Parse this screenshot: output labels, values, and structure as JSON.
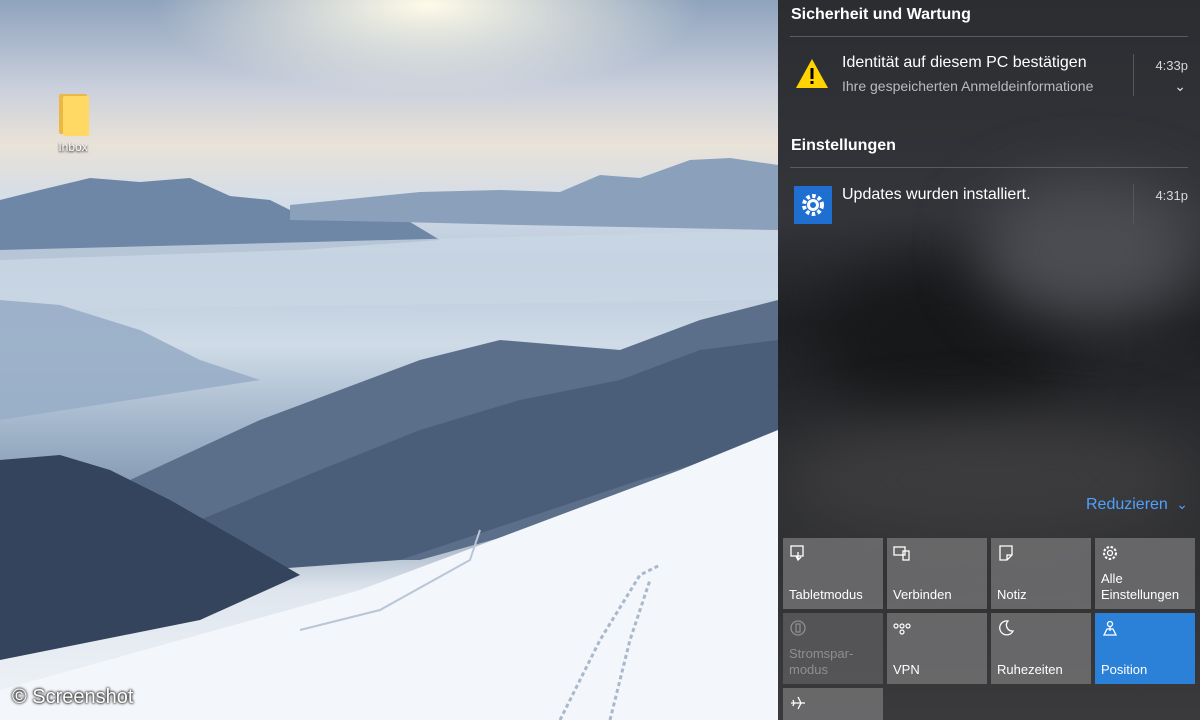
{
  "desktop": {
    "icons": [
      {
        "label": "Inbox",
        "icon": "folder-icon"
      }
    ],
    "watermark": "© Screenshot"
  },
  "action_center": {
    "sections": [
      {
        "title": "Sicherheit und Wartung",
        "notifications": [
          {
            "icon": "warning-icon",
            "title": "Identität auf diesem PC bestätigen",
            "subtitle": "Ihre gespeicherten Anmeldeinformatione",
            "time": "4:33p"
          }
        ]
      },
      {
        "title": "Einstellungen",
        "notifications": [
          {
            "icon": "gear-icon",
            "title": "Updates wurden installiert.",
            "time": "4:31p"
          }
        ]
      }
    ],
    "collapse_label": "Reduzieren",
    "accent_color": "#2b80d8",
    "quick_actions": [
      {
        "label": "Tabletmodus",
        "icon": "tablet-mode-icon",
        "state": "normal"
      },
      {
        "label": "Verbinden",
        "icon": "connect-icon",
        "state": "normal"
      },
      {
        "label": "Notiz",
        "icon": "note-icon",
        "state": "normal"
      },
      {
        "label": "Alle\nEinstellungen",
        "icon": "settings-icon",
        "state": "normal"
      },
      {
        "label": "Stromspar-\nmodus",
        "icon": "battery-saver-icon",
        "state": "disabled"
      },
      {
        "label": "VPN",
        "icon": "vpn-icon",
        "state": "normal"
      },
      {
        "label": "Ruhezeiten",
        "icon": "moon-icon",
        "state": "normal"
      },
      {
        "label": "Position",
        "icon": "location-icon",
        "state": "active"
      },
      {
        "label": "",
        "icon": "airplane-icon",
        "state": "normal"
      }
    ]
  }
}
